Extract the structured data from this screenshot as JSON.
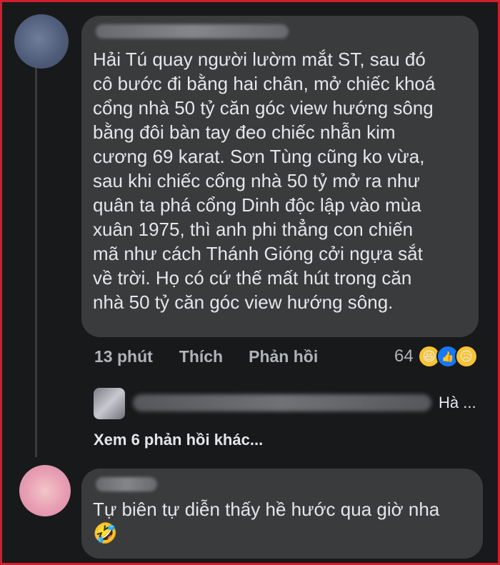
{
  "comment": {
    "author_name": "",
    "text": "Hải Tú quay người lườm mắt ST, sau đó\ncô bước đi bằng hai chân, mở chiếc khoá\ncổng nhà 50 tỷ căn góc view hướng sông\nbằng đôi bàn tay đeo chiếc nhẫn kim\ncương 69 karat. Sơn Tùng cũng ko vừa,\nsau khi chiếc cổng nhà 50 tỷ mở ra như\nquân ta phá cổng Dinh độc lập vào mùa\nxuân 1975, thì anh phi thẳng con chiến\nmã như cách Thánh Gióng cởi ngựa sắt\nvề trời. Họ có cứ thế mất hút trong căn\nnhà 50 tỷ căn góc view hướng sông.",
    "time": "13 phút",
    "like_label": "Thích",
    "reply_label": "Phản hồi",
    "reaction_count": "64",
    "reactions": [
      "haha-emoji",
      "like-reaction",
      "sad-emoji"
    ]
  },
  "reply_preview": {
    "tail_text": "Hà ..."
  },
  "more_replies_label": "Xem 6 phản hồi khác...",
  "comment2": {
    "author_name": "",
    "text": "Tự biên tự diễn thấy hề hước qua giờ nha",
    "emoji": "🤣"
  },
  "colors": {
    "background": "#18191a",
    "bubble": "#3a3b3c",
    "frame": "#d11f2d",
    "text": "#e4e6eb",
    "secondary_text": "#b0b3b8"
  }
}
